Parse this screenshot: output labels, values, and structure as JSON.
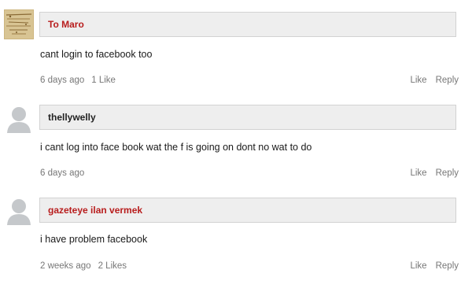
{
  "colors": {
    "name_red": "#b81d1d",
    "name_dark": "#222222",
    "meta_gray": "#777777",
    "bar_bg": "#eeeeee",
    "bar_border": "#d2d2d2"
  },
  "comments": [
    {
      "author": "To Maro",
      "avatar": "vintage-text-avatar",
      "text": "cant login to facebook too",
      "time": "6 days ago",
      "likes": "1 Like",
      "like_label": "Like",
      "reply_label": "Reply"
    },
    {
      "author": "thellywelly",
      "avatar": "default-silhouette-avatar",
      "text": "i cant log into face book wat the f is going on dont no wat to do",
      "time": "6 days ago",
      "likes": "",
      "like_label": "Like",
      "reply_label": "Reply"
    },
    {
      "author": "gazeteye ilan vermek",
      "avatar": "default-silhouette-avatar",
      "text": "i have problem facebook",
      "time": "2 weeks ago",
      "likes": "2 Likes",
      "like_label": "Like",
      "reply_label": "Reply"
    }
  ]
}
